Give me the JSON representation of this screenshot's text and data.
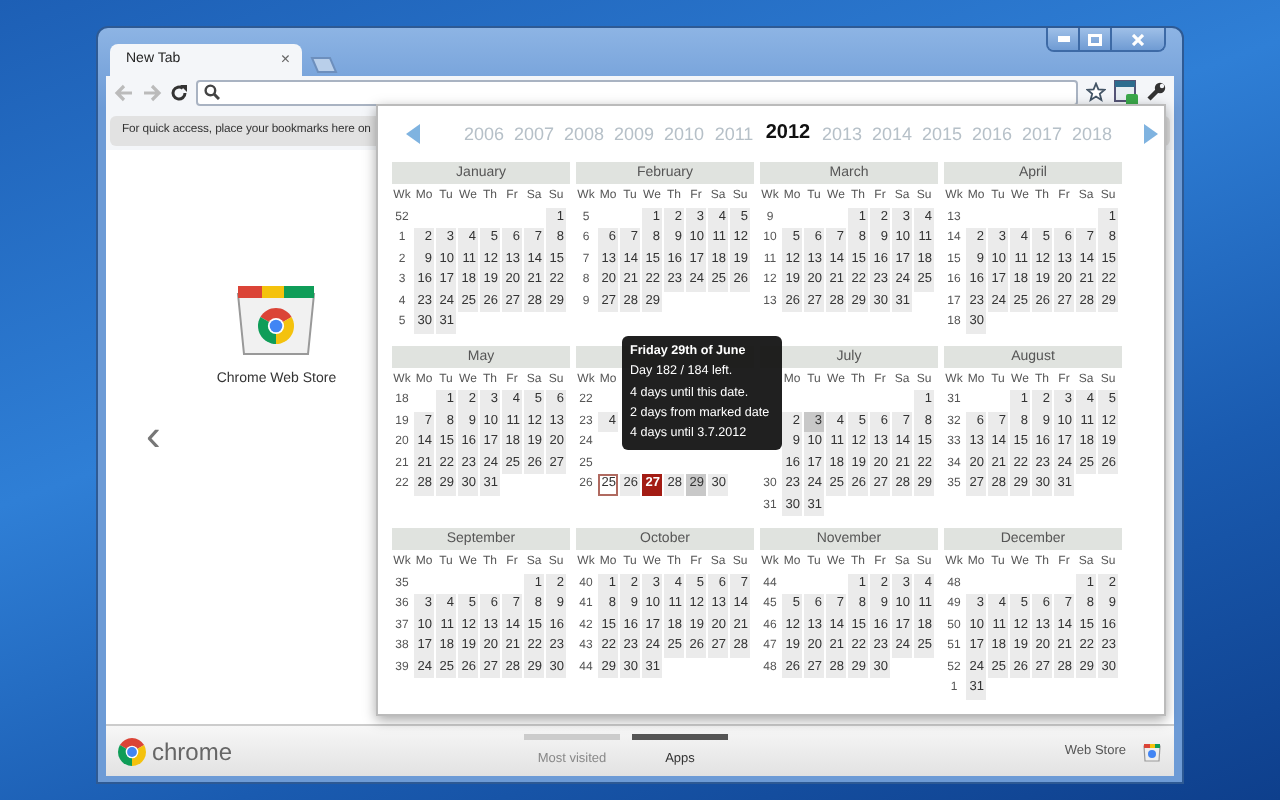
{
  "browser": {
    "tabs": [
      {
        "label": "New Tab",
        "close": "×",
        "selected": true
      }
    ],
    "bookmark_bar": {
      "text": "For quick access, place your bookmarks here on"
    },
    "new_tab_page": {
      "prev_arrow": "‹",
      "apps": [
        {
          "label": "Chrome Web Store"
        }
      ]
    },
    "bottom_bar": {
      "logo_text": "chrome",
      "sections": [
        {
          "label": "Most visited",
          "selected": false
        },
        {
          "label": "Apps",
          "selected": true
        }
      ],
      "web_store": "Web Store"
    }
  },
  "calendar": {
    "years": [
      {
        "label": "2006",
        "selected": false
      },
      {
        "label": "2007",
        "selected": false
      },
      {
        "label": "2008",
        "selected": false
      },
      {
        "label": "2009",
        "selected": false
      },
      {
        "label": "2010",
        "selected": false
      },
      {
        "label": "2011",
        "selected": false
      },
      {
        "label": "2012",
        "selected": true
      },
      {
        "label": "2013",
        "selected": false
      },
      {
        "label": "2014",
        "selected": false
      },
      {
        "label": "2015",
        "selected": false
      },
      {
        "label": "2016",
        "selected": false
      },
      {
        "label": "2017",
        "selected": false
      },
      {
        "label": "2018",
        "selected": false
      }
    ],
    "months": [
      {
        "name": "January",
        "rows": [
          {
            "kind": "header",
            "week": "Wk",
            "days": [
              "Mo",
              "Tu",
              "We",
              "Th",
              "Fr",
              "Sa",
              "Su"
            ]
          },
          {
            "week": "52",
            "pad_start": true,
            "days": [
              "1"
            ]
          },
          {
            "week": "1",
            "days": [
              "2",
              "3",
              "4",
              "5",
              "6",
              "7",
              "8"
            ]
          },
          {
            "week": "2",
            "days": [
              "9",
              "10",
              "11",
              "12",
              "13",
              "14",
              "15"
            ]
          },
          {
            "week": "3",
            "days": [
              "16",
              "17",
              "18",
              "19",
              "20",
              "21",
              "22"
            ]
          },
          {
            "week": "4",
            "days": [
              "23",
              "24",
              "25",
              "26",
              "27",
              "28",
              "29"
            ]
          },
          {
            "week": "5",
            "days": [
              "30",
              "31"
            ]
          }
        ]
      },
      {
        "name": "February",
        "rows": [
          {
            "kind": "header",
            "week": "Wk",
            "days": [
              "Mo",
              "Tu",
              "We",
              "Th",
              "Fr",
              "Sa",
              "Su"
            ]
          },
          {
            "week": "5",
            "pad_start": true,
            "days": [
              "1",
              "2",
              "3",
              "4",
              "5"
            ]
          },
          {
            "week": "6",
            "days": [
              "6",
              "7",
              "8",
              "9",
              "10",
              "11",
              "12"
            ]
          },
          {
            "week": "7",
            "days": [
              "13",
              "14",
              "15",
              "16",
              "17",
              "18",
              "19"
            ]
          },
          {
            "week": "8",
            "days": [
              "20",
              "21",
              "22",
              "23",
              "24",
              "25",
              "26"
            ]
          },
          {
            "week": "9",
            "days": [
              "27",
              "28",
              "29"
            ]
          }
        ]
      },
      {
        "name": "March",
        "rows": [
          {
            "kind": "header",
            "week": "Wk",
            "days": [
              "Mo",
              "Tu",
              "We",
              "Th",
              "Fr",
              "Sa",
              "Su"
            ]
          },
          {
            "week": "9",
            "pad_start": true,
            "days": [
              "1",
              "2",
              "3",
              "4"
            ]
          },
          {
            "week": "10",
            "days": [
              "5",
              "6",
              "7",
              "8",
              "9",
              "10",
              "11"
            ]
          },
          {
            "week": "11",
            "days": [
              "12",
              "13",
              "14",
              "15",
              "16",
              "17",
              "18"
            ]
          },
          {
            "week": "12",
            "days": [
              "19",
              "20",
              "21",
              "22",
              "23",
              "24",
              "25"
            ]
          },
          {
            "week": "13",
            "days": [
              "26",
              "27",
              "28",
              "29",
              "30",
              "31"
            ]
          }
        ]
      },
      {
        "name": "April",
        "rows": [
          {
            "kind": "header",
            "week": "Wk",
            "days": [
              "Mo",
              "Tu",
              "We",
              "Th",
              "Fr",
              "Sa",
              "Su"
            ]
          },
          {
            "week": "13",
            "pad_start": true,
            "days": [
              "1"
            ]
          },
          {
            "week": "14",
            "days": [
              "2",
              "3",
              "4",
              "5",
              "6",
              "7",
              "8"
            ]
          },
          {
            "week": "15",
            "days": [
              "9",
              "10",
              "11",
              "12",
              "13",
              "14",
              "15"
            ]
          },
          {
            "week": "16",
            "days": [
              "16",
              "17",
              "18",
              "19",
              "20",
              "21",
              "22"
            ]
          },
          {
            "week": "17",
            "days": [
              "23",
              "24",
              "25",
              "26",
              "27",
              "28",
              "29"
            ]
          },
          {
            "week": "18",
            "days": [
              "30"
            ]
          }
        ]
      },
      {
        "name": "May",
        "rows": [
          {
            "kind": "header",
            "week": "Wk",
            "days": [
              "Mo",
              "Tu",
              "We",
              "Th",
              "Fr",
              "Sa",
              "Su"
            ]
          },
          {
            "week": "18",
            "pad_start": true,
            "days": [
              "1",
              "2",
              "3",
              "4",
              "5",
              "6"
            ]
          },
          {
            "week": "19",
            "days": [
              "7",
              "8",
              "9",
              "10",
              "11",
              "12",
              "13"
            ]
          },
          {
            "week": "20",
            "days": [
              "14",
              "15",
              "16",
              "17",
              "18",
              "19",
              "20"
            ]
          },
          {
            "week": "21",
            "days": [
              "21",
              "22",
              "23",
              "24",
              "25",
              "26",
              "27"
            ]
          },
          {
            "week": "22",
            "days": [
              "28",
              "29",
              "30",
              "31"
            ]
          }
        ]
      },
      {
        "rows": [
          {
            "kind": "header",
            "week": "Wk",
            "days": [
              "Mo"
            ]
          },
          {
            "week": "22"
          },
          {
            "week": "23",
            "days": [
              "4"
            ]
          },
          {
            "week": "24"
          },
          {
            "week": "25"
          },
          {
            "week": "26",
            "days": [
              {
                "text": "25",
                "kind": "marked"
              },
              "26",
              {
                "text": "27",
                "kind": "today"
              },
              "28",
              {
                "text": "29",
                "kind": "highlighted"
              },
              "30"
            ]
          }
        ]
      },
      {
        "name": "July",
        "rows": [
          {
            "kind": "header",
            "pad_start": true,
            "days": [
              "Mo",
              "Tu",
              "We",
              "Th",
              "Fr",
              "Sa",
              "Su"
            ]
          },
          {
            "pad_start": true,
            "days": [
              "1"
            ]
          },
          {
            "days": [
              "2",
              {
                "text": "3",
                "kind": "highlighted"
              },
              "4",
              "5",
              "6",
              "7",
              "8"
            ]
          },
          {
            "days": [
              "9",
              "10",
              "11",
              "12",
              "13",
              "14",
              "15"
            ]
          },
          {
            "days": [
              "16",
              "17",
              "18",
              "19",
              "20",
              "21",
              "22"
            ]
          },
          {
            "week": "30",
            "days": [
              "23",
              "24",
              "25",
              "26",
              "27",
              "28",
              "29"
            ]
          },
          {
            "week": "31",
            "days": [
              "30",
              "31"
            ]
          }
        ]
      },
      {
        "name": "August",
        "rows": [
          {
            "kind": "header",
            "week": "Wk",
            "days": [
              "Mo",
              "Tu",
              "We",
              "Th",
              "Fr",
              "Sa",
              "Su"
            ]
          },
          {
            "week": "31",
            "pad_start": true,
            "days": [
              "1",
              "2",
              "3",
              "4",
              "5"
            ]
          },
          {
            "week": "32",
            "days": [
              "6",
              "7",
              "8",
              "9",
              "10",
              "11",
              "12"
            ]
          },
          {
            "week": "33",
            "days": [
              "13",
              "14",
              "15",
              "16",
              "17",
              "18",
              "19"
            ]
          },
          {
            "week": "34",
            "days": [
              "20",
              "21",
              "22",
              "23",
              "24",
              "25",
              "26"
            ]
          },
          {
            "week": "35",
            "days": [
              "27",
              "28",
              "29",
              "30",
              "31"
            ]
          }
        ]
      },
      {
        "name": "September",
        "rows": [
          {
            "kind": "header",
            "week": "Wk",
            "days": [
              "Mo",
              "Tu",
              "We",
              "Th",
              "Fr",
              "Sa",
              "Su"
            ]
          },
          {
            "week": "35",
            "pad_start": true,
            "days": [
              "1",
              "2"
            ]
          },
          {
            "week": "36",
            "days": [
              "3",
              "4",
              "5",
              "6",
              "7",
              "8",
              "9"
            ]
          },
          {
            "week": "37",
            "days": [
              "10",
              "11",
              "12",
              "13",
              "14",
              "15",
              "16"
            ]
          },
          {
            "week": "38",
            "days": [
              "17",
              "18",
              "19",
              "20",
              "21",
              "22",
              "23"
            ]
          },
          {
            "week": "39",
            "days": [
              "24",
              "25",
              "26",
              "27",
              "28",
              "29",
              "30"
            ]
          }
        ]
      },
      {
        "name": "October",
        "rows": [
          {
            "kind": "header",
            "week": "Wk",
            "days": [
              "Mo",
              "Tu",
              "We",
              "Th",
              "Fr",
              "Sa",
              "Su"
            ]
          },
          {
            "week": "40",
            "days": [
              "1",
              "2",
              "3",
              "4",
              "5",
              "6",
              "7"
            ]
          },
          {
            "week": "41",
            "days": [
              "8",
              "9",
              "10",
              "11",
              "12",
              "13",
              "14"
            ]
          },
          {
            "week": "42",
            "days": [
              "15",
              "16",
              "17",
              "18",
              "19",
              "20",
              "21"
            ]
          },
          {
            "week": "43",
            "days": [
              "22",
              "23",
              "24",
              "25",
              "26",
              "27",
              "28"
            ]
          },
          {
            "week": "44",
            "days": [
              "29",
              "30",
              "31"
            ]
          }
        ]
      },
      {
        "name": "November",
        "rows": [
          {
            "kind": "header",
            "week": "Wk",
            "days": [
              "Mo",
              "Tu",
              "We",
              "Th",
              "Fr",
              "Sa",
              "Su"
            ]
          },
          {
            "week": "44",
            "pad_start": true,
            "days": [
              "1",
              "2",
              "3",
              "4"
            ]
          },
          {
            "week": "45",
            "days": [
              "5",
              "6",
              "7",
              "8",
              "9",
              "10",
              "11"
            ]
          },
          {
            "week": "46",
            "days": [
              "12",
              "13",
              "14",
              "15",
              "16",
              "17",
              "18"
            ]
          },
          {
            "week": "47",
            "days": [
              "19",
              "20",
              "21",
              "22",
              "23",
              "24",
              "25"
            ]
          },
          {
            "week": "48",
            "days": [
              "26",
              "27",
              "28",
              "29",
              "30"
            ]
          }
        ]
      },
      {
        "name": "December",
        "rows": [
          {
            "kind": "header",
            "week": "Wk",
            "days": [
              "Mo",
              "Tu",
              "We",
              "Th",
              "Fr",
              "Sa",
              "Su"
            ]
          },
          {
            "week": "48",
            "pad_start": true,
            "days": [
              "1",
              "2"
            ]
          },
          {
            "week": "49",
            "days": [
              "3",
              "4",
              "5",
              "6",
              "7",
              "8",
              "9"
            ]
          },
          {
            "week": "50",
            "days": [
              "10",
              "11",
              "12",
              "13",
              "14",
              "15",
              "16"
            ]
          },
          {
            "week": "51",
            "days": [
              "17",
              "18",
              "19",
              "20",
              "21",
              "22",
              "23"
            ]
          },
          {
            "week": "52",
            "days": [
              "24",
              "25",
              "26",
              "27",
              "28",
              "29",
              "30"
            ]
          },
          {
            "week": "1",
            "days": [
              "31"
            ]
          }
        ]
      }
    ],
    "tooltip": {
      "title": "Friday 29th of June",
      "lines": [
        "Day 182 / 184 left.",
        "4 days until this date.",
        "2 days from marked date",
        "4 days until 3.7.2012"
      ]
    }
  }
}
